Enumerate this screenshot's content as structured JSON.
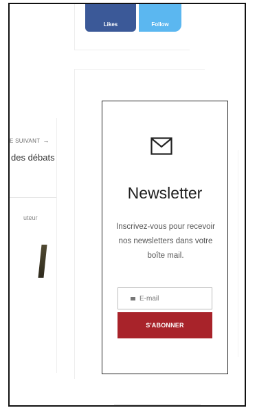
{
  "social": {
    "likes_label": "Likes",
    "follow_label": "Follow",
    "likes_color": "#3b5998",
    "follow_color": "#5bb7f0"
  },
  "article_nav": {
    "next_label": "E SUIVANT",
    "next_arrow": "→",
    "next_title": "des débats"
  },
  "author": {
    "label": "uteur"
  },
  "newsletter": {
    "icon": "envelope-icon",
    "title": "Newsletter",
    "description": "Inscrivez-vous pour recevoir nos newsletters dans votre boîte mail.",
    "email_placeholder": "E-mail",
    "subscribe_label": "S'ABONNER",
    "button_color": "#a8232a"
  }
}
